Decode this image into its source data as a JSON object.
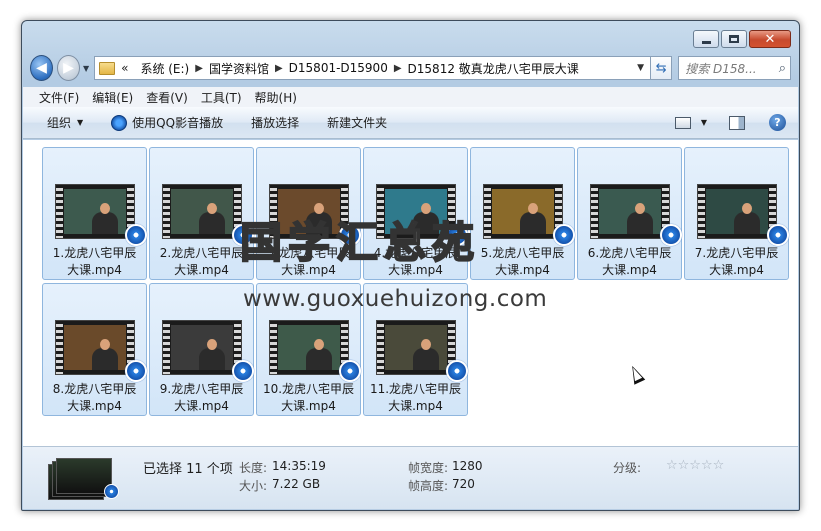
{
  "titlebar": {
    "minimize_glyph": "",
    "maximize_glyph": "",
    "close_glyph": "✕"
  },
  "nav": {
    "back_glyph": "◀",
    "forward_glyph": "▶",
    "dropdown_glyph": "▼",
    "breadcrumb_overflow": "«",
    "breadcrumbs": [
      "系统 (E:)",
      "国学资料馆",
      "D15801-D15900",
      "D15812 敬真龙虎八宅甲辰大课"
    ],
    "separator": "▶",
    "refresh_glyph": "⇆",
    "search_placeholder": "搜索 D158...",
    "search_icon": "search-icon"
  },
  "menu": [
    "文件(F)",
    "编辑(E)",
    "查看(V)",
    "工具(T)",
    "帮助(H)"
  ],
  "toolbar": {
    "organize": "组织",
    "play_qq": "使用QQ影音播放",
    "play_selection": "播放选择",
    "new_folder": "新建文件夹",
    "help_glyph": "?"
  },
  "files": [
    {
      "line1": "1.龙虎八宅甲辰",
      "line2": "大课.mp4",
      "bg": "#3d5a4e"
    },
    {
      "line1": "2.龙虎八宅甲辰",
      "line2": "大课.mp4",
      "bg": "#41574a"
    },
    {
      "line1": "3.龙虎八宅甲辰",
      "line2": "大课.mp4",
      "bg": "#6b4a2c"
    },
    {
      "line1": "4.龙虎八宅甲辰",
      "line2": "大课.mp4",
      "bg": "#2f7a8c"
    },
    {
      "line1": "5.龙虎八宅甲辰",
      "line2": "大课.mp4",
      "bg": "#8a6a2a"
    },
    {
      "line1": "6.龙虎八宅甲辰",
      "line2": "大课.mp4",
      "bg": "#3a5a50"
    },
    {
      "line1": "7.龙虎八宅甲辰",
      "line2": "大课.mp4",
      "bg": "#2e4a44"
    },
    {
      "line1": "8.龙虎八宅甲辰",
      "line2": "大课.mp4",
      "bg": "#6a4a2a"
    },
    {
      "line1": "9.龙虎八宅甲辰",
      "line2": "大课.mp4",
      "bg": "#3b3b3b"
    },
    {
      "line1": "10.龙虎八宅甲辰",
      "line2": "大课.mp4",
      "bg": "#3e5a4a"
    },
    {
      "line1": "11.龙虎八宅甲辰",
      "line2": "大课.mp4",
      "bg": "#4a4a3a"
    }
  ],
  "watermark": {
    "text": "国学汇总苑",
    "url": "www.guoxuehuizong.com"
  },
  "details": {
    "selected": "已选择 11 个项",
    "length_label": "长度:",
    "length_value": "14:35:19",
    "size_label": "大小:",
    "size_value": "7.22 GB",
    "frame_width_label": "帧宽度:",
    "frame_width_value": "1280",
    "frame_height_label": "帧高度:",
    "frame_height_value": "720",
    "rating_label": "分级:",
    "rating_stars": "☆☆☆☆☆",
    "rating": 0
  }
}
